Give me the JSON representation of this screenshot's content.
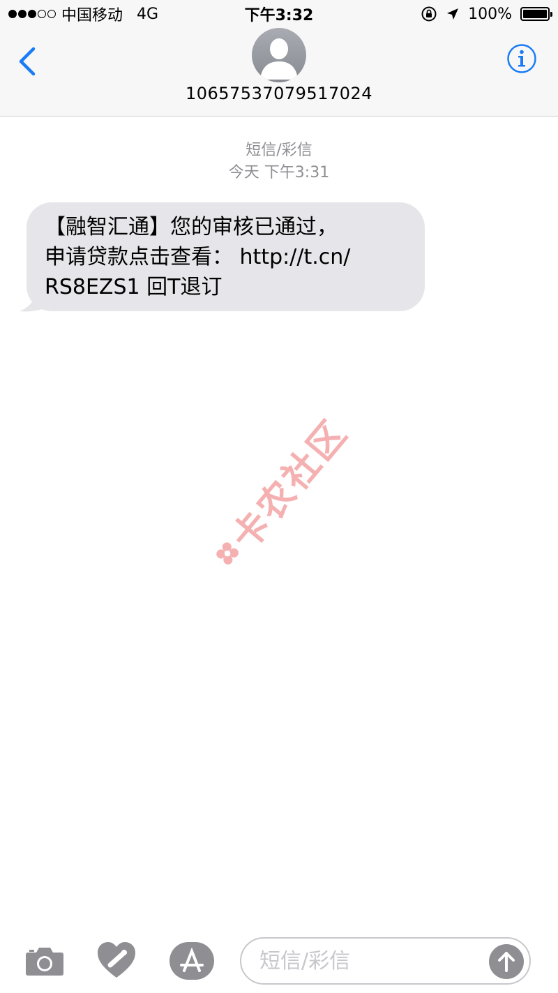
{
  "status_bar": {
    "carrier": "中国移动",
    "network": "4G",
    "time": "下午3:32",
    "battery_percent": "100%",
    "battery_level": 1.0,
    "signal_strength": 3,
    "signal_max": 5
  },
  "header": {
    "contact_number": "10657537079517024"
  },
  "thread": {
    "label": "短信/彩信",
    "date": "今天 下午3:31"
  },
  "messages": [
    {
      "direction": "incoming",
      "text": "【融智汇通】您的审核已通过，\n申请贷款点击查看： http://t.cn/\nRS8EZS1 回T退订"
    }
  ],
  "watermark": {
    "text": "卡农社区"
  },
  "input_bar": {
    "placeholder": "短信/彩信"
  },
  "icons": {
    "back": "chevron-left-icon",
    "info": "info-icon",
    "camera": "camera-icon",
    "digital_touch": "digital-touch-icon",
    "app_store": "app-store-icon",
    "send": "arrow-up-icon"
  },
  "colors": {
    "accent": "#1a7cf5",
    "bubble_incoming": "#e5e5ea",
    "secondary_text": "#8e8e93",
    "watermark": "#f4a4a4"
  }
}
